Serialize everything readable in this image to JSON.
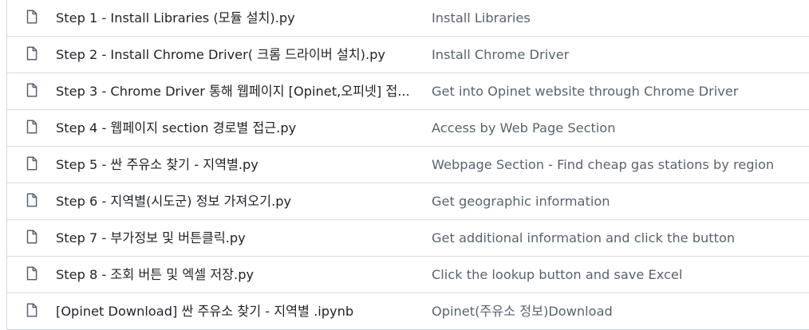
{
  "files": [
    {
      "name": "Step 1 - Install Libraries (모듈 설치).py",
      "commit": "Install Libraries",
      "icon": "file-icon"
    },
    {
      "name": "Step 2 - Install Chrome Driver( 크롬 드라이버 설치).py",
      "commit": "Install Chrome Driver",
      "icon": "file-icon"
    },
    {
      "name": "Step 3 - Chrome Driver 통해 웹페이지 [Opinet,오피넷] 접...",
      "commit": "Get into Opinet website through Chrome Driver",
      "icon": "file-icon"
    },
    {
      "name": "Step 4 - 웹페이지 section 경로별 접근.py",
      "commit": "Access by Web Page Section",
      "icon": "file-icon"
    },
    {
      "name": "Step 5 - 싼 주유소 찾기 - 지역별.py",
      "commit": "Webpage Section - Find cheap gas stations by region",
      "icon": "file-icon"
    },
    {
      "name": "Step 6 - 지역별(시도군) 정보 가져오기.py",
      "commit": "Get geographic information",
      "icon": "file-icon"
    },
    {
      "name": "Step 7 - 부가정보 및 버튼클릭.py",
      "commit": "Get additional information and click the button",
      "icon": "file-icon"
    },
    {
      "name": "Step 8 - 조회 버튼 및 엑셀 저장.py",
      "commit": "Click the lookup button and save Excel",
      "icon": "file-icon"
    },
    {
      "name": "[Opinet Download] 싼 주유소 찾기 - 지역별 .ipynb",
      "commit": "Opinet(주유소 정보)Download",
      "icon": "file-icon"
    }
  ],
  "colors": {
    "file_name": "#1f2328",
    "commit_message": "#59636e",
    "icon": "#59636e",
    "border": "#d0d7de"
  }
}
